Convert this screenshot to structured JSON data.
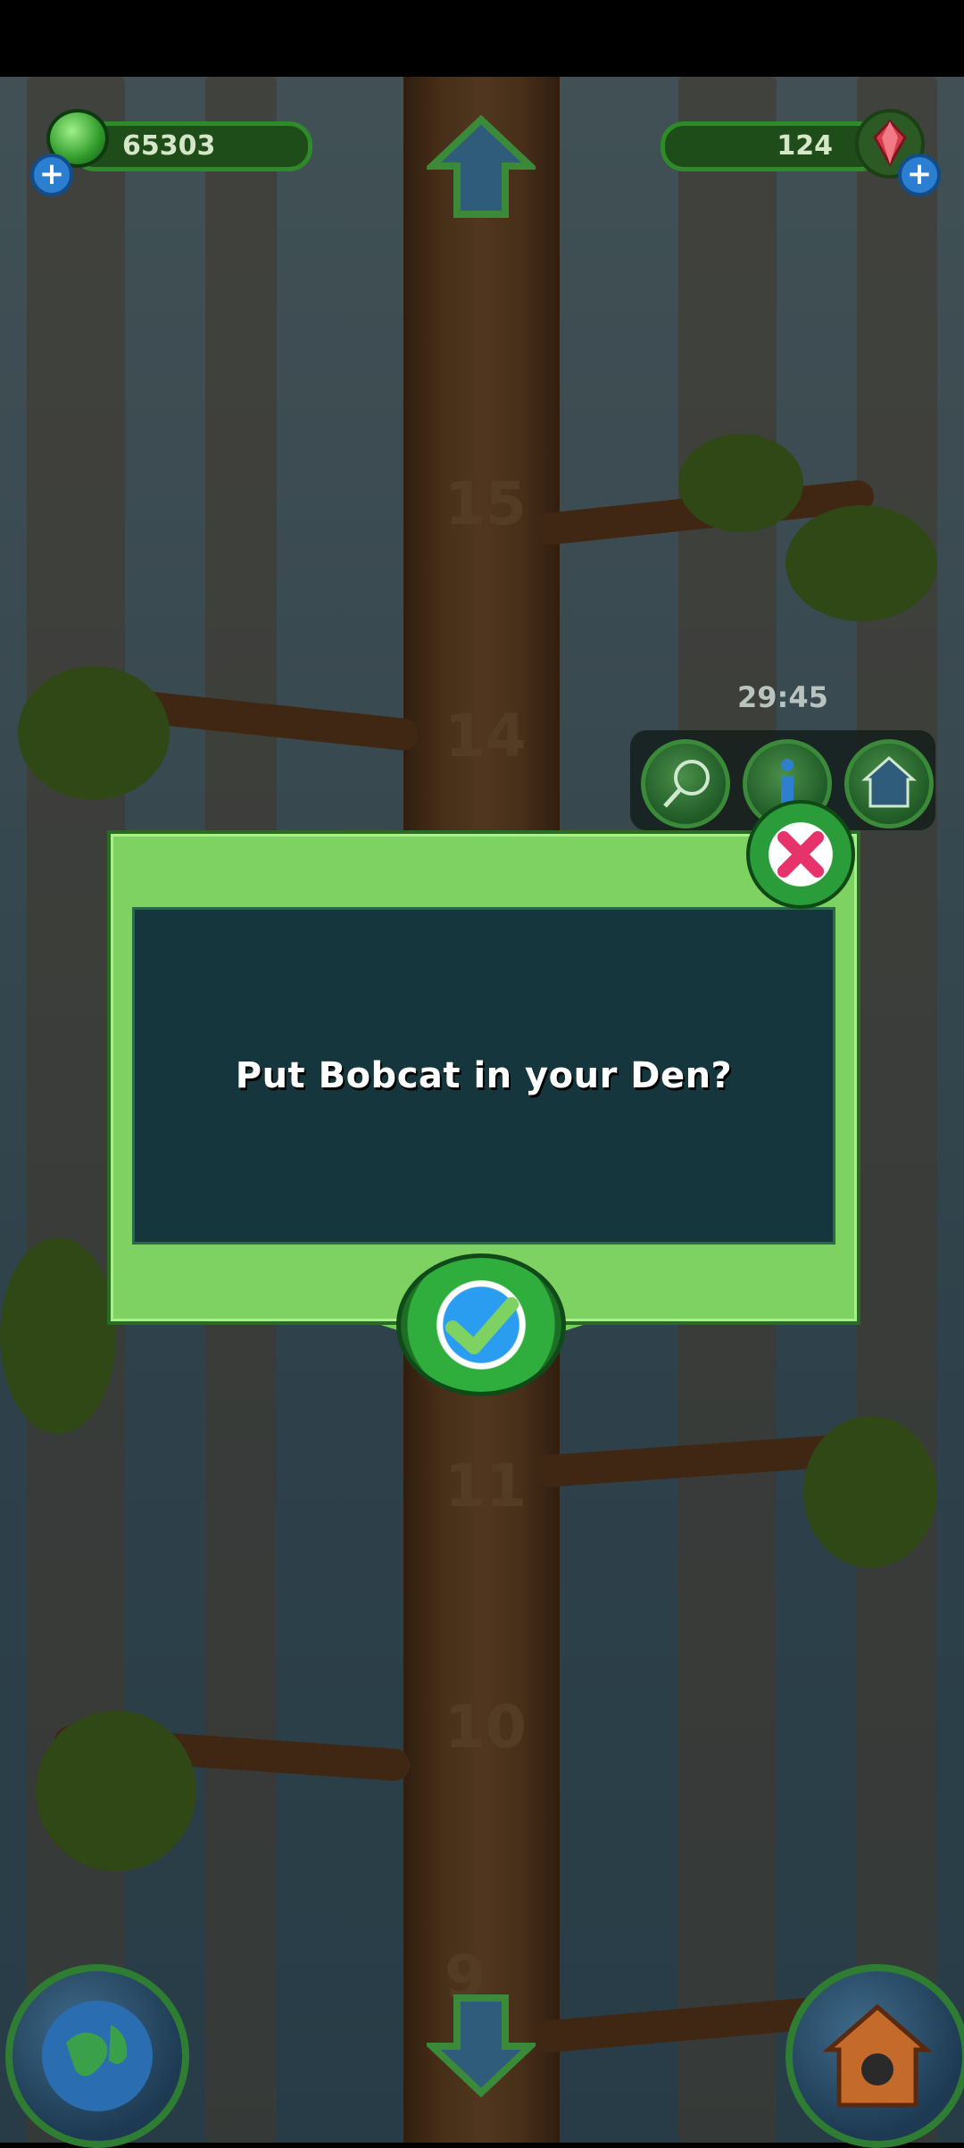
{
  "hud": {
    "gems_value": "65303",
    "rubies_value": "124",
    "timer": "29:45"
  },
  "icons": {
    "gem": "green-gem-icon",
    "ruby": "ruby-icon",
    "plus": "plus-icon",
    "up": "arrow-up-icon",
    "down": "arrow-down-icon",
    "net": "net-icon",
    "info": "info-icon",
    "den": "den-icon",
    "globe": "globe-icon",
    "house": "house-icon",
    "close": "close-icon",
    "check": "check-icon"
  },
  "tree": {
    "floors": [
      "15",
      "14",
      "11",
      "10",
      "9"
    ]
  },
  "dialog": {
    "message": "Put Bobcat in your Den?"
  },
  "colors": {
    "dialog_frame": "#7ed262",
    "dialog_inner": "#16363e",
    "hud_bar": "#1e4d1a"
  }
}
